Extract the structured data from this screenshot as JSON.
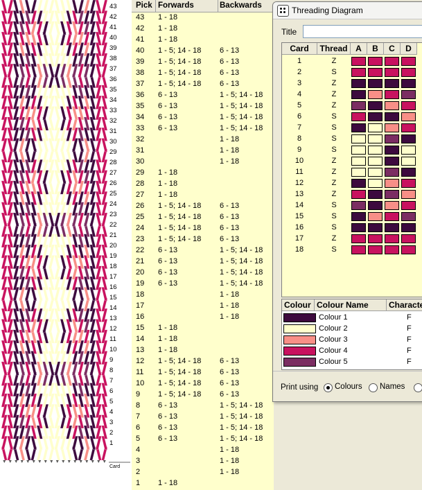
{
  "colors": {
    "c1": "#3d0a3e",
    "c2": "#ffffcc",
    "c3": "#f88f87",
    "c4": "#c8125f",
    "c5": "#7b2d62"
  },
  "band": {
    "card_axis_label": "Card",
    "pick_labels": [
      "43",
      "42",
      "41",
      "40",
      "39",
      "38",
      "37",
      "36",
      "35",
      "34",
      "33",
      "32",
      "31",
      "30",
      "29",
      "28",
      "27",
      "26",
      "25",
      "24",
      "23",
      "22",
      "21",
      "20",
      "19",
      "18",
      "17",
      "16",
      "15",
      "14",
      "13",
      "12",
      "11",
      "10",
      "9",
      "8",
      "7",
      "6",
      "5",
      "4",
      "3",
      "2",
      "1"
    ]
  },
  "pick_table": {
    "headers": {
      "pick": "Pick",
      "forwards": "Forwards",
      "backwards": "Backwards"
    },
    "rows": [
      {
        "pick": "43",
        "fwd": "1 - 18",
        "bwd": ""
      },
      {
        "pick": "42",
        "fwd": "1 - 18",
        "bwd": ""
      },
      {
        "pick": "41",
        "fwd": "1 - 18",
        "bwd": ""
      },
      {
        "pick": "40",
        "fwd": "1 - 5; 14 - 18",
        "bwd": "6 - 13"
      },
      {
        "pick": "39",
        "fwd": "1 - 5; 14 - 18",
        "bwd": "6 - 13"
      },
      {
        "pick": "38",
        "fwd": "1 - 5; 14 - 18",
        "bwd": "6 - 13"
      },
      {
        "pick": "37",
        "fwd": "1 - 5; 14 - 18",
        "bwd": "6 - 13"
      },
      {
        "pick": "36",
        "fwd": "6 - 13",
        "bwd": "1 - 5; 14 - 18"
      },
      {
        "pick": "35",
        "fwd": "6 - 13",
        "bwd": "1 - 5; 14 - 18"
      },
      {
        "pick": "34",
        "fwd": "6 - 13",
        "bwd": "1 - 5; 14 - 18"
      },
      {
        "pick": "33",
        "fwd": "6 - 13",
        "bwd": "1 - 5; 14 - 18"
      },
      {
        "pick": "32",
        "fwd": "",
        "bwd": "1 - 18"
      },
      {
        "pick": "31",
        "fwd": "",
        "bwd": "1 - 18"
      },
      {
        "pick": "30",
        "fwd": "",
        "bwd": "1 - 18"
      },
      {
        "pick": "29",
        "fwd": "1 - 18",
        "bwd": ""
      },
      {
        "pick": "28",
        "fwd": "1 - 18",
        "bwd": ""
      },
      {
        "pick": "27",
        "fwd": "1 - 18",
        "bwd": ""
      },
      {
        "pick": "26",
        "fwd": "1 - 5; 14 - 18",
        "bwd": "6 - 13"
      },
      {
        "pick": "25",
        "fwd": "1 - 5; 14 - 18",
        "bwd": "6 - 13"
      },
      {
        "pick": "24",
        "fwd": "1 - 5; 14 - 18",
        "bwd": "6 - 13"
      },
      {
        "pick": "23",
        "fwd": "1 - 5; 14 - 18",
        "bwd": "6 - 13"
      },
      {
        "pick": "22",
        "fwd": "6 - 13",
        "bwd": "1 - 5; 14 - 18"
      },
      {
        "pick": "21",
        "fwd": "6 - 13",
        "bwd": "1 - 5; 14 - 18"
      },
      {
        "pick": "20",
        "fwd": "6 - 13",
        "bwd": "1 - 5; 14 - 18"
      },
      {
        "pick": "19",
        "fwd": "6 - 13",
        "bwd": "1 - 5; 14 - 18"
      },
      {
        "pick": "18",
        "fwd": "",
        "bwd": "1 - 18"
      },
      {
        "pick": "17",
        "fwd": "",
        "bwd": "1 - 18"
      },
      {
        "pick": "16",
        "fwd": "",
        "bwd": "1 - 18"
      },
      {
        "pick": "15",
        "fwd": "1 - 18",
        "bwd": ""
      },
      {
        "pick": "14",
        "fwd": "1 - 18",
        "bwd": ""
      },
      {
        "pick": "13",
        "fwd": "1 - 18",
        "bwd": ""
      },
      {
        "pick": "12",
        "fwd": "1 - 5; 14 - 18",
        "bwd": "6 - 13"
      },
      {
        "pick": "11",
        "fwd": "1 - 5; 14 - 18",
        "bwd": "6 - 13"
      },
      {
        "pick": "10",
        "fwd": "1 - 5; 14 - 18",
        "bwd": "6 - 13"
      },
      {
        "pick": "9",
        "fwd": "1 - 5; 14 - 18",
        "bwd": "6 - 13"
      },
      {
        "pick": "8",
        "fwd": "6 - 13",
        "bwd": "1 - 5; 14 - 18"
      },
      {
        "pick": "7",
        "fwd": "6 - 13",
        "bwd": "1 - 5; 14 - 18"
      },
      {
        "pick": "6",
        "fwd": "6 - 13",
        "bwd": "1 - 5; 14 - 18"
      },
      {
        "pick": "5",
        "fwd": "6 - 13",
        "bwd": "1 - 5; 14 - 18"
      },
      {
        "pick": "4",
        "fwd": "",
        "bwd": "1 - 18"
      },
      {
        "pick": "3",
        "fwd": "",
        "bwd": "1 - 18"
      },
      {
        "pick": "2",
        "fwd": "",
        "bwd": "1 - 18"
      },
      {
        "pick": "1",
        "fwd": "1 - 18",
        "bwd": ""
      }
    ]
  },
  "threading_window": {
    "title": "Threading Diagram",
    "title_field_label": "Title",
    "title_field_value": "",
    "grid_headers": {
      "card": "Card",
      "thread": "Thread",
      "a": "A",
      "b": "B",
      "c": "C",
      "d": "D"
    },
    "cards": [
      {
        "card": "1",
        "thread": "Z",
        "holes": [
          "c4",
          "c4",
          "c4",
          "c4"
        ]
      },
      {
        "card": "2",
        "thread": "S",
        "holes": [
          "c4",
          "c4",
          "c4",
          "c4"
        ]
      },
      {
        "card": "3",
        "thread": "Z",
        "holes": [
          "c1",
          "c1",
          "c1",
          "c1"
        ]
      },
      {
        "card": "4",
        "thread": "Z",
        "holes": [
          "c1",
          "c3",
          "c4",
          "c5"
        ]
      },
      {
        "card": "5",
        "thread": "Z",
        "holes": [
          "c5",
          "c1",
          "c3",
          "c4"
        ]
      },
      {
        "card": "6",
        "thread": "S",
        "holes": [
          "c4",
          "c1",
          "c1",
          "c3"
        ]
      },
      {
        "card": "7",
        "thread": "S",
        "holes": [
          "c1",
          "c2",
          "c3",
          "c4"
        ]
      },
      {
        "card": "8",
        "thread": "S",
        "holes": [
          "c2",
          "c2",
          "c5",
          "c1"
        ]
      },
      {
        "card": "9",
        "thread": "S",
        "holes": [
          "c2",
          "c2",
          "c1",
          "c2"
        ]
      },
      {
        "card": "10",
        "thread": "Z",
        "holes": [
          "c2",
          "c2",
          "c1",
          "c2"
        ]
      },
      {
        "card": "11",
        "thread": "Z",
        "holes": [
          "c2",
          "c2",
          "c5",
          "c1"
        ]
      },
      {
        "card": "12",
        "thread": "Z",
        "holes": [
          "c1",
          "c2",
          "c3",
          "c4"
        ]
      },
      {
        "card": "13",
        "thread": "Z",
        "holes": [
          "c4",
          "c1",
          "c5",
          "c3"
        ]
      },
      {
        "card": "14",
        "thread": "S",
        "holes": [
          "c5",
          "c1",
          "c3",
          "c4"
        ]
      },
      {
        "card": "15",
        "thread": "S",
        "holes": [
          "c1",
          "c3",
          "c4",
          "c5"
        ]
      },
      {
        "card": "16",
        "thread": "S",
        "holes": [
          "c1",
          "c1",
          "c1",
          "c1"
        ]
      },
      {
        "card": "17",
        "thread": "Z",
        "holes": [
          "c4",
          "c4",
          "c4",
          "c4"
        ]
      },
      {
        "card": "18",
        "thread": "S",
        "holes": [
          "c4",
          "c4",
          "c4",
          "c4"
        ]
      }
    ],
    "colour_list": {
      "headers": {
        "colour": "Colour",
        "name": "Colour Name",
        "character": "Characte"
      },
      "items": [
        {
          "key": "c1",
          "name": "Colour 1",
          "char": "F"
        },
        {
          "key": "c2",
          "name": "Colour 2",
          "char": "F"
        },
        {
          "key": "c3",
          "name": "Colour 3",
          "char": "F"
        },
        {
          "key": "c4",
          "name": "Colour 4",
          "char": "F"
        },
        {
          "key": "c5",
          "name": "Colour 5",
          "char": "F"
        }
      ]
    },
    "print_using": {
      "label": "Print using",
      "options": [
        {
          "label": "Colours",
          "selected": true
        },
        {
          "label": "Names",
          "selected": false
        },
        {
          "label": "",
          "selected": false
        }
      ]
    }
  }
}
